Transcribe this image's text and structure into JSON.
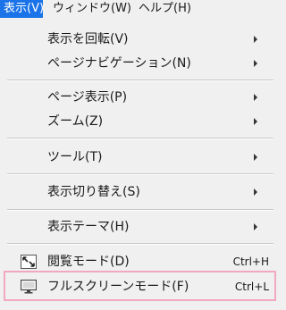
{
  "menubar": {
    "items": [
      {
        "label": "表示(V)"
      },
      {
        "label": "ウィンドウ(W)"
      },
      {
        "label": "ヘルプ(H)"
      }
    ]
  },
  "menu": {
    "items": [
      {
        "label": "表示を回転(V)",
        "submenu": true
      },
      {
        "label": "ページナビゲーション(N)",
        "submenu": true
      },
      {
        "label": "ページ表示(P)",
        "submenu": true
      },
      {
        "label": "ズーム(Z)",
        "submenu": true
      },
      {
        "label": "ツール(T)",
        "submenu": true
      },
      {
        "label": "表示切り替え(S)",
        "submenu": true
      },
      {
        "label": "表示テーマ(H)",
        "submenu": true
      },
      {
        "label": "閲覧モード(D)",
        "shortcut": "Ctrl+H",
        "icon": "expand-arrows-icon"
      },
      {
        "label": "フルスクリーンモード(F)",
        "shortcut": "Ctrl+L",
        "icon": "monitor-icon"
      }
    ]
  },
  "colors": {
    "active_menu_bg": "#1a73e8",
    "highlight_border": "#f2a7c3",
    "menu_bg": "#f0f0f0"
  }
}
